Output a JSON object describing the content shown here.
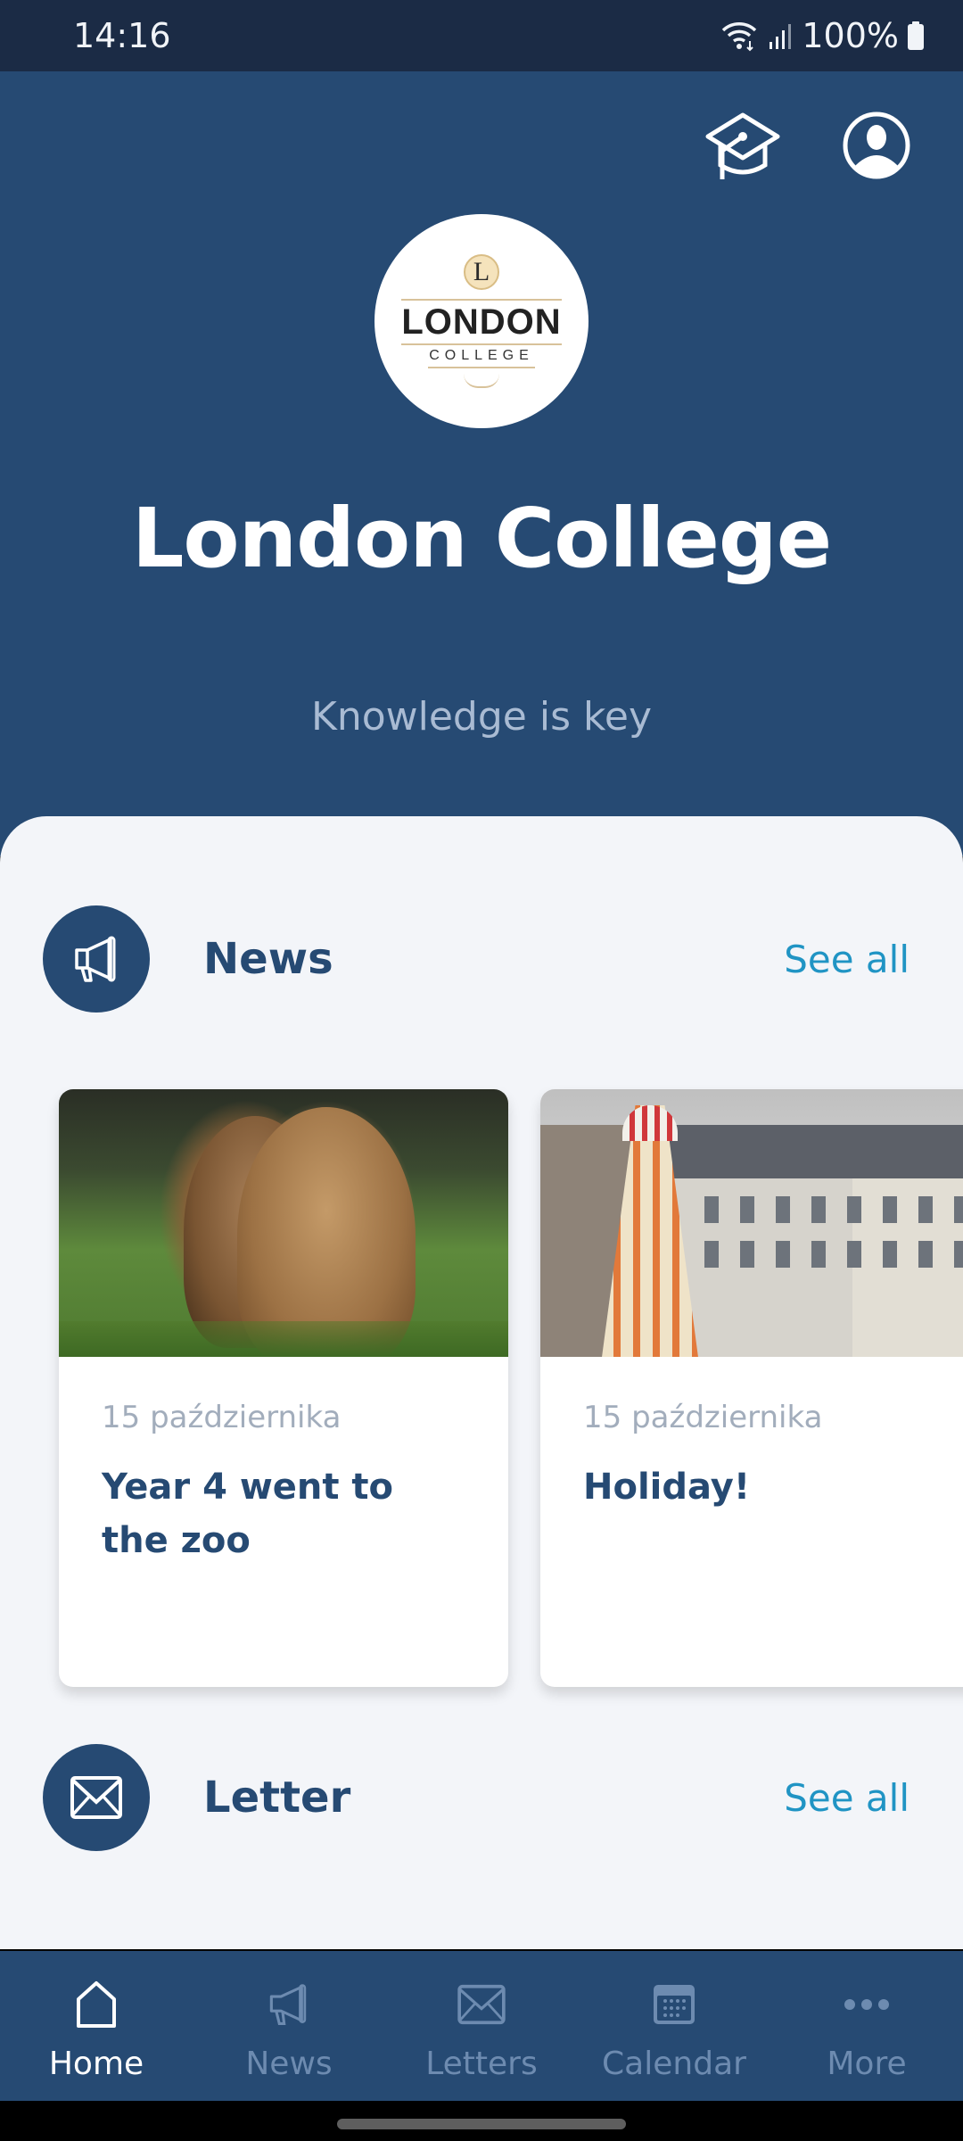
{
  "status_bar": {
    "time": "14:16",
    "battery": "100%",
    "icons": [
      "wifi-icon",
      "signal-icon",
      "battery-icon"
    ]
  },
  "header": {
    "actions": [
      {
        "icon": "graduation-cap-icon"
      },
      {
        "icon": "profile-icon"
      }
    ],
    "logo": {
      "initial": "L",
      "main_text": "LONDON",
      "sub_text": "COLLEGE"
    },
    "title": "London College",
    "tagline": "Knowledge is key"
  },
  "sections": {
    "news": {
      "icon": "megaphone-icon",
      "title": "News",
      "see_all": "See all",
      "cards": [
        {
          "date": "15 października",
          "title": "Year 4 went to the zoo",
          "image": "lions-photo"
        },
        {
          "date": "15 października",
          "title": "Holiday!",
          "image": "helter-skelter-photo"
        }
      ]
    },
    "letter": {
      "icon": "envelope-icon",
      "title": "Letter",
      "see_all": "See all"
    }
  },
  "bottom_nav": {
    "active": "Home",
    "items": [
      {
        "label": "Home",
        "icon": "home-icon"
      },
      {
        "label": "News",
        "icon": "megaphone-icon"
      },
      {
        "label": "Letters",
        "icon": "envelope-icon"
      },
      {
        "label": "Calendar",
        "icon": "calendar-icon"
      },
      {
        "label": "More",
        "icon": "more-icon"
      }
    ]
  },
  "colors": {
    "primary": "#264a73",
    "status_bar": "#1b2b45",
    "accent_link": "#2094c4",
    "background": "#f3f5f9",
    "muted_text": "#a2adbc",
    "nav_inactive": "#6d8bb0"
  }
}
